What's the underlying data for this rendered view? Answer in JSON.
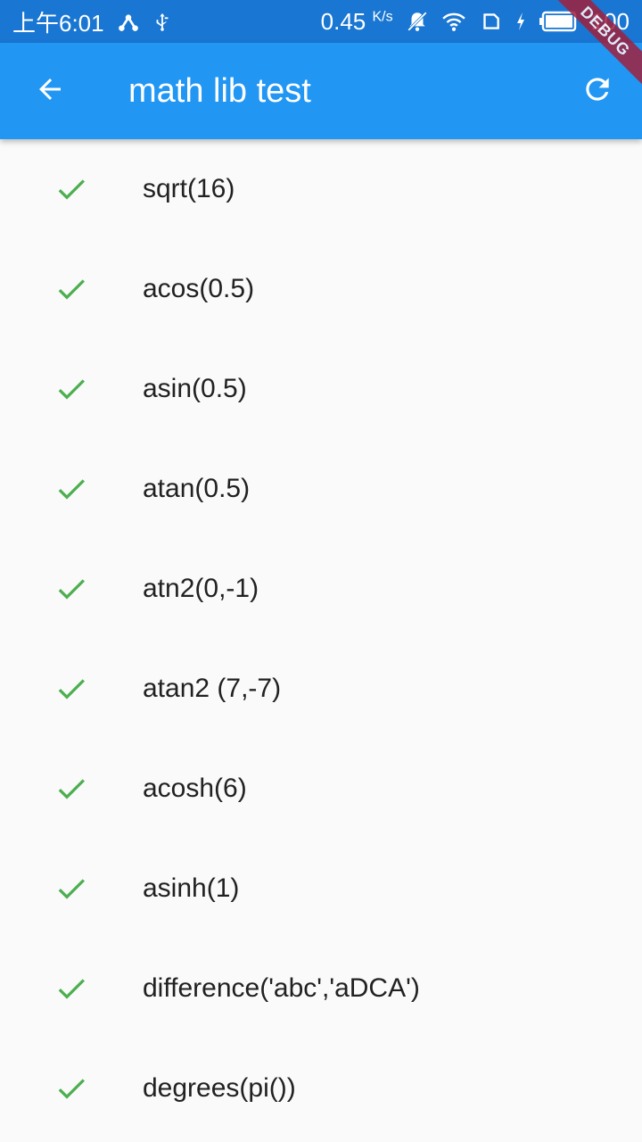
{
  "status_bar": {
    "time": "上午6:01",
    "network_speed": "0.45",
    "network_unit": "K/s",
    "battery": "100"
  },
  "app_bar": {
    "title": "math lib test",
    "debug_label": "DEBUG"
  },
  "colors": {
    "status_bar": "#1976d2",
    "app_bar": "#2196f3",
    "check": "#4caf50",
    "background": "#fafafa"
  },
  "tests": [
    {
      "label": "sqrt(16)",
      "status": "passed",
      "icon": "check-icon"
    },
    {
      "label": "acos(0.5)",
      "status": "passed",
      "icon": "check-icon"
    },
    {
      "label": "asin(0.5)",
      "status": "passed",
      "icon": "check-icon"
    },
    {
      "label": "atan(0.5)",
      "status": "passed",
      "icon": "check-icon"
    },
    {
      "label": "atn2(0,-1)",
      "status": "passed",
      "icon": "check-icon"
    },
    {
      "label": "atan2 (7,-7)",
      "status": "passed",
      "icon": "check-icon"
    },
    {
      "label": "acosh(6)",
      "status": "passed",
      "icon": "check-icon"
    },
    {
      "label": "asinh(1)",
      "status": "passed",
      "icon": "check-icon"
    },
    {
      "label": "difference('abc','aDCA')",
      "status": "passed",
      "icon": "check-icon"
    },
    {
      "label": "degrees(pi())",
      "status": "passed",
      "icon": "check-icon"
    }
  ]
}
